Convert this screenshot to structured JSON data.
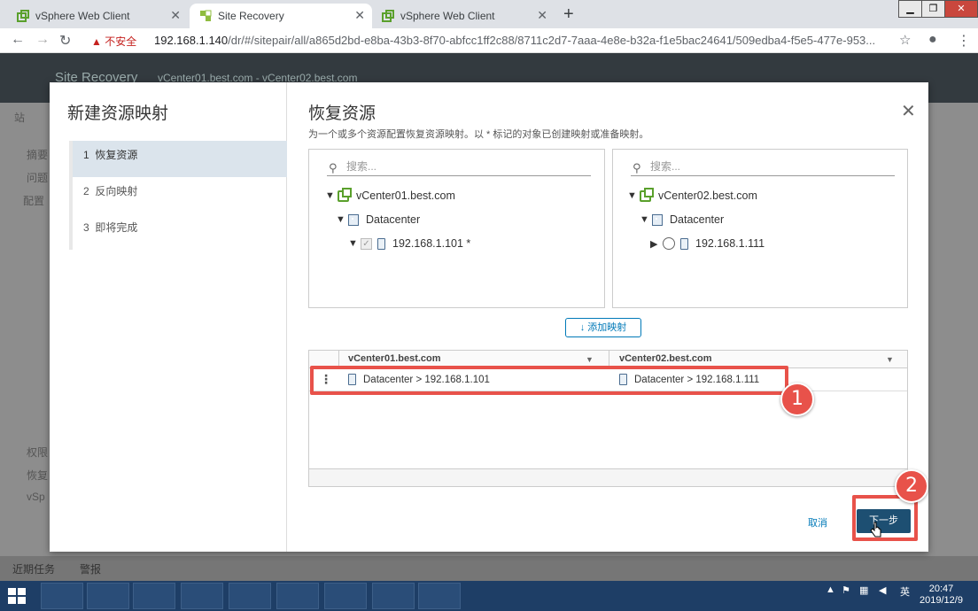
{
  "browser": {
    "tabs": [
      {
        "label": "vSphere Web Client"
      },
      {
        "label": "Site Recovery"
      },
      {
        "label": "vSphere Web Client"
      }
    ],
    "security_label": "不安全",
    "url_host": "192.168.1.140",
    "url_path": "/dr/#/sitepair/all/a865d2bd-e8ba-43b3-8f70-abfcc1ff2c88/8711c2d7-7aaa-4e8e-b32a-f1e5bac24641/509edba4-f5e5-477e-953..."
  },
  "app": {
    "title": "Site Recovery",
    "subtitle": "vCenter01.best.com - vCenter02.best.com",
    "bg_nav": [
      "站",
      "摘要",
      "问题",
      "配置",
      "权限",
      "恢复",
      "vSp"
    ],
    "bottom_tabs": [
      "近期任务",
      "警报"
    ]
  },
  "modal": {
    "wizard_title": "新建资源映射",
    "steps": [
      {
        "num": "1",
        "label": "恢复资源"
      },
      {
        "num": "2",
        "label": "反向映射"
      },
      {
        "num": "3",
        "label": "即将完成"
      }
    ],
    "content_title": "恢复资源",
    "description": "为一个或多个资源配置恢复资源映射。以 * 标记的对象已创建映射或准备映射。",
    "search_placeholder": "搜索...",
    "left_tree": {
      "vcenter": "vCenter01.best.com",
      "datacenter": "Datacenter",
      "host": "192.168.1.101 *"
    },
    "right_tree": {
      "vcenter": "vCenter02.best.com",
      "datacenter": "Datacenter",
      "host": "192.168.1.111"
    },
    "add_mapping_label": "添加映射",
    "grid": {
      "columns": [
        "vCenter01.best.com",
        "vCenter02.best.com"
      ],
      "rows": [
        {
          "source": "Datacenter > 192.168.1.101",
          "target": "Datacenter > 192.168.1.111"
        }
      ]
    },
    "cancel_label": "取消",
    "next_label": "下一步"
  },
  "annotations": {
    "callout1": "1",
    "callout2": "2",
    "highlight_color": "#e8524a"
  },
  "taskbar": {
    "ime": "英",
    "time": "20:47",
    "date": "2019/12/9"
  }
}
